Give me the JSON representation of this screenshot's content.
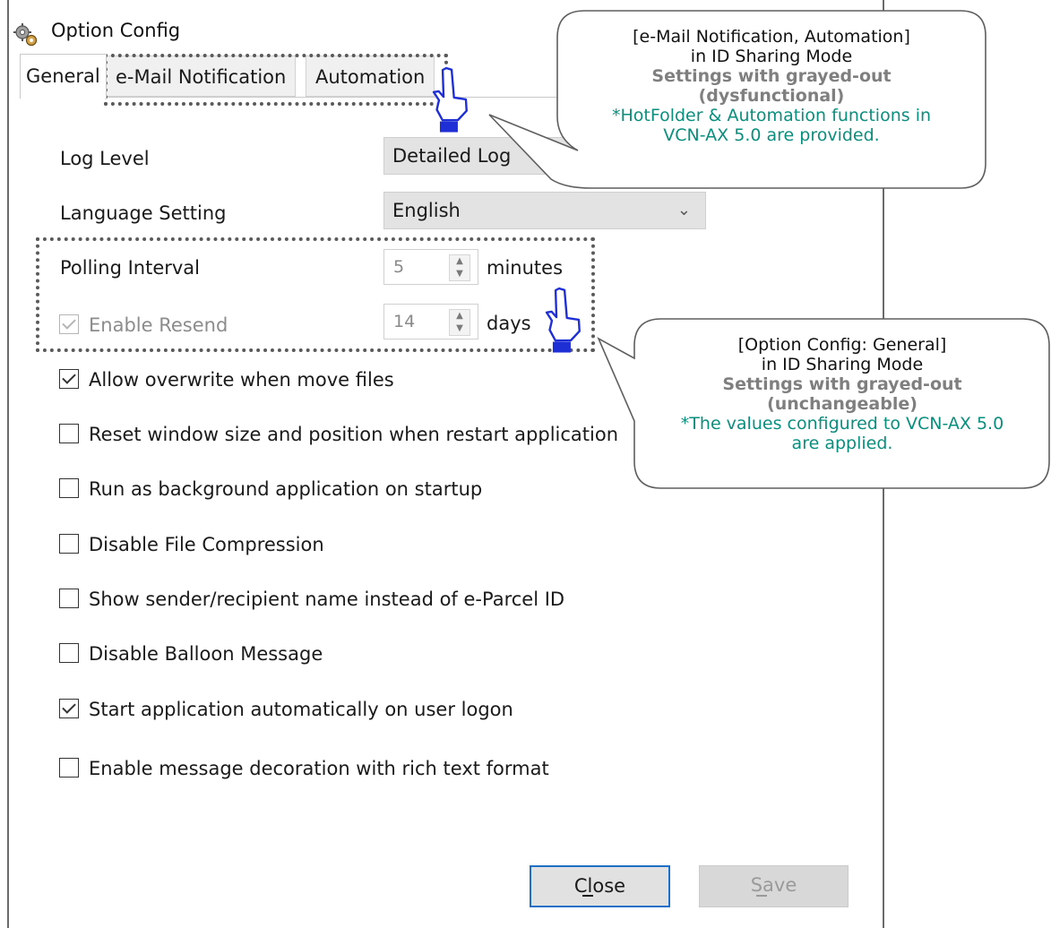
{
  "window": {
    "title": "Option Config"
  },
  "tabs": [
    {
      "label": "General"
    },
    {
      "label": "e-Mail Notification"
    },
    {
      "label": "Automation"
    }
  ],
  "fields": {
    "log_level": {
      "label": "Log Level",
      "value": "Detailed Log"
    },
    "language": {
      "label": "Language Setting",
      "value": "English"
    },
    "polling": {
      "label": "Polling Interval",
      "value": "5",
      "unit": "minutes"
    },
    "resend": {
      "label": "Enable Resend",
      "value": "14",
      "unit": "days",
      "checked": true
    }
  },
  "checkboxes": [
    {
      "label": "Allow overwrite when move files",
      "checked": true
    },
    {
      "label": "Reset window size and position when restart application",
      "checked": false
    },
    {
      "label": "Run as background application on startup",
      "checked": false
    },
    {
      "label": "Disable File Compression",
      "checked": false
    },
    {
      "label": "Show sender/recipient name instead of e-Parcel ID",
      "checked": false
    },
    {
      "label": "Disable Balloon Message",
      "checked": false
    },
    {
      "label": "Start application automatically on user logon",
      "checked": true
    },
    {
      "label": "Enable message decoration with rich text format",
      "checked": false
    }
  ],
  "buttons": {
    "close": "Close",
    "save": "Save"
  },
  "callouts": {
    "top": {
      "line1": "[e-Mail Notification, Automation]",
      "line2": "in ID Sharing Mode",
      "line3": "Settings with grayed-out",
      "line4": "(dysfunctional)",
      "line5": "*HotFolder & Automation functions in",
      "line6": "VCN-AX 5.0 are provided."
    },
    "bottom": {
      "line1": "[Option Config: General]",
      "line2": "in ID Sharing Mode",
      "line3": "Settings with grayed-out",
      "line4": "(unchangeable)",
      "line5": "*The values configured to VCN-AX 5.0",
      "line6": "are applied."
    }
  },
  "colors": {
    "accent_focus": "#1d6fc7",
    "callout_gray": "#7f7f7f",
    "callout_teal": "#0a8f7e",
    "pointer_blue": "#1f2fd6"
  }
}
